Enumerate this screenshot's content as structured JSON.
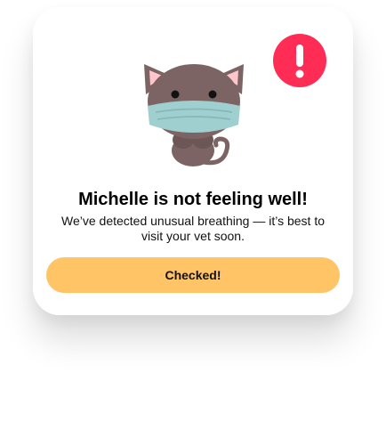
{
  "dialog": {
    "title": "Michelle is not feeling well!",
    "message": "We’ve detected unusual breathing — it’s best to visit your vet soon.",
    "button_label": "Checked!",
    "icons": {
      "illustration": "cat-wearing-mask-icon",
      "badge": "exclamation-alert-icon"
    }
  },
  "colors": {
    "button": "#ffc466",
    "alert": "#ff2d55",
    "cat_fur": "#7c6464",
    "mask": "#a0cfd0"
  }
}
